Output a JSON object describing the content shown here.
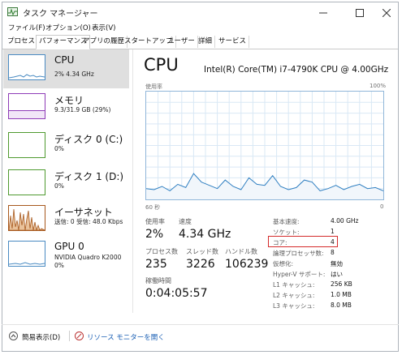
{
  "window": {
    "title": "タスク マネージャー",
    "controls": {
      "minimize": "—",
      "maximize": "☐",
      "close": "✕"
    }
  },
  "menu": [
    "ファイル(F)",
    "オプション(O)",
    "表示(V)"
  ],
  "tabs": [
    "プロセス",
    "パフォーマンス",
    "アプリの履歴",
    "スタートアップ",
    "ユーザー",
    "詳細",
    "サービス"
  ],
  "active_tab": "パフォーマンス",
  "sidebar": {
    "items": [
      {
        "name": "CPU",
        "sub": "2%  4.34 GHz",
        "color": "#4a8bc2"
      },
      {
        "name": "メモリ",
        "sub": "9.3/31.9 GB (29%)",
        "color": "#8e3bb7"
      },
      {
        "name": "ディスク 0 (C:)",
        "sub": "0%",
        "color": "#4f9a2f"
      },
      {
        "name": "ディスク 1 (D:)",
        "sub": "0%",
        "color": "#4f9a2f"
      },
      {
        "name": "イーサネット",
        "sub": "送信: 0 受信: 48.0 Kbps",
        "color": "#a7581d"
      },
      {
        "name": "GPU 0",
        "sub": "NVIDIA Quadro K2000",
        "sub2": "0%",
        "color": "#4a8bc2"
      }
    ]
  },
  "main": {
    "title": "CPU",
    "model": "Intel(R) Core(TM) i7-4790K CPU @ 4.00GHz",
    "graph": {
      "top_left": "使用率",
      "top_right": "100%",
      "bottom_left": "60 秒",
      "bottom_right": "0"
    },
    "stats": {
      "usage_label": "使用率",
      "usage": "2%",
      "speed_label": "速度",
      "speed": "4.34 GHz",
      "process_label": "プロセス数",
      "process": "235",
      "thread_label": "スレッド数",
      "thread": "3226",
      "handle_label": "ハンドル数",
      "handle": "106239",
      "uptime_label": "稼働時間",
      "uptime": "0:04:05:57"
    },
    "specs": [
      {
        "label": "基本速度:",
        "value": "4.00 GHz"
      },
      {
        "label": "ソケット:",
        "value": "1"
      },
      {
        "label": "コア:",
        "value": "4"
      },
      {
        "label": "論理プロセッサ数:",
        "value": "8"
      },
      {
        "label": "仮想化:",
        "value": "無効"
      },
      {
        "label": "Hyper-V サポート:",
        "value": "はい"
      },
      {
        "label": "L1 キャッシュ:",
        "value": "256 KB"
      },
      {
        "label": "L2 キャッシュ:",
        "value": "1.0 MB"
      },
      {
        "label": "L3 キャッシュ:",
        "value": "8.0 MB"
      }
    ]
  },
  "chart_data": {
    "type": "line",
    "ylim": [
      0,
      100
    ],
    "x": [
      0,
      2,
      4,
      6,
      8,
      10,
      12,
      14,
      16,
      18,
      20,
      22,
      24,
      26,
      28,
      30,
      32,
      34,
      36,
      38,
      40,
      42,
      44,
      46,
      48,
      50,
      52,
      54,
      56,
      58,
      60
    ],
    "values": [
      10,
      9,
      12,
      8,
      14,
      11,
      24,
      16,
      13,
      10,
      18,
      12,
      9,
      20,
      14,
      13,
      22,
      12,
      9,
      11,
      18,
      16,
      8,
      10,
      13,
      9,
      12,
      14,
      10,
      11,
      8
    ]
  },
  "footer": {
    "brief": "簡易表示(D)",
    "monitor": "リソース モニターを開く"
  }
}
